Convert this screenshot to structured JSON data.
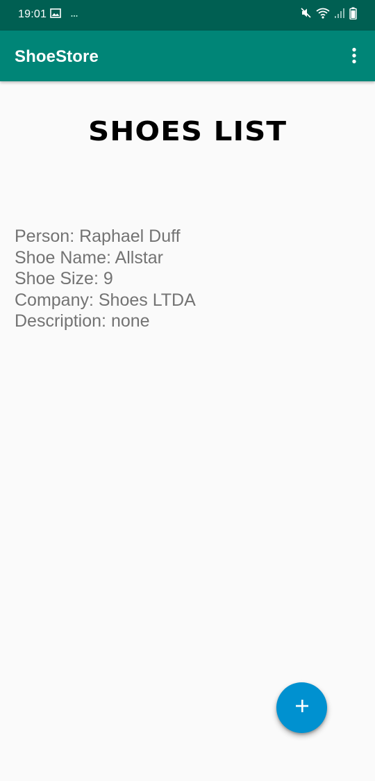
{
  "status_bar": {
    "time": "19:01",
    "left_icons": [
      "image-icon",
      "more-notifications-icon"
    ],
    "right_icons": [
      "mute-icon",
      "wifi-icon",
      "signal-icon",
      "battery-icon"
    ]
  },
  "app_bar": {
    "title": "ShoeStore",
    "menu_icon": "overflow-menu-icon"
  },
  "heading": "SHOES LIST",
  "shoes": [
    {
      "person": "Person: Raphael Duff",
      "shoe_name": "Shoe Name: Allstar",
      "shoe_size": "Shoe Size: 9",
      "company": "Company: Shoes LTDA",
      "description": "Description: none"
    }
  ],
  "fab": {
    "icon": "plus-icon"
  },
  "colors": {
    "status_bar": "#005f52",
    "app_bar": "#008577",
    "background": "#fafafa",
    "text_secondary": "#737373",
    "fab": "#0091d0"
  }
}
